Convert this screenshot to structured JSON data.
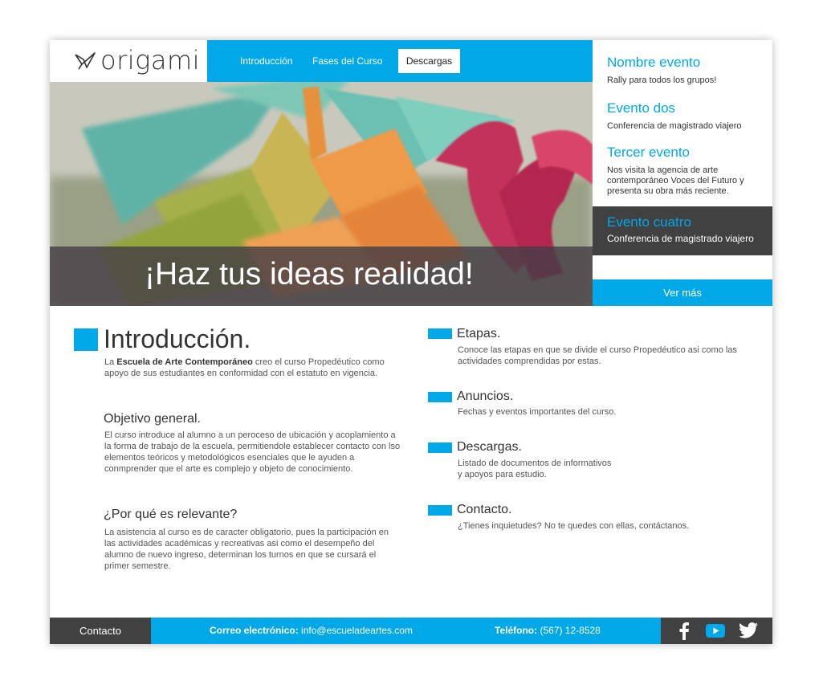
{
  "brand": {
    "logo_text": "origami"
  },
  "nav": {
    "items": [
      {
        "label": "Introducción"
      },
      {
        "label": "Fases del Curso"
      },
      {
        "label": "Descargas"
      }
    ]
  },
  "hero": {
    "headline": "¡Haz tus ideas realidad!"
  },
  "events": {
    "items": [
      {
        "title": "Nombre evento",
        "desc": "Rally para todos los grupos!"
      },
      {
        "title": "Evento dos",
        "desc": "Conferencia de magistrado viajero"
      },
      {
        "title": "Tercer evento",
        "desc": "Nos visita la agencia de arte contemporáneo Voces del Futuro y presenta su obra más reciente."
      },
      {
        "title": "Evento cuatro",
        "desc": "Conferencia de magistrado viajero"
      }
    ],
    "more_label": "Ver más"
  },
  "intro": {
    "title": "Introducción.",
    "body_prefix": "La ",
    "body_bold": "Escuela de Arte Contemporáneo",
    "body_suffix": " creo el curso Propedéutico como apoyo de sus estudiantes en conformidad con el estatuto en vigencia."
  },
  "objective": {
    "title": "Objetivo general.",
    "body": "El curso introduce al alumno a un peroceso de ubicación y acoplamiento a la forma de trabajo de la escuela, permitiendole establecer contacto con lso elementos teóricos y metodológicos esenciales que le ayuden a conmprender que el arte es complejo y objeto de conocimiento."
  },
  "relevance": {
    "title": "¿Por qué es relevante?",
    "body": "La asistencia al curso es de caracter obligatorio, pues la participación en las actividades académicas y recreativas asi como el desempeño del alumno de nuevo ingreso, determinan los turnos en que se cursará el primer semestre."
  },
  "sections": [
    {
      "title": "Etapas.",
      "body": "Conoce las etapas en que se divide el curso Propedéutico asi como las actividades comprendidas por estas."
    },
    {
      "title": "Anuncios.",
      "body": "Fechas y eventos importantes del curso."
    },
    {
      "title": "Descargas.",
      "body_line1": "Listado de documentos de informativos",
      "body_line2": "y apoyos para estudio."
    },
    {
      "title": "Contacto.",
      "body": "¿Tienes inquietudes? No te quedes con ellas, contáctanos."
    }
  ],
  "footer": {
    "contact_label": "Contacto",
    "email_label": "Correo electrónico:",
    "email_value": "info@escueladeartes.com",
    "phone_label": "Teléfono:",
    "phone_value": "(567) 12-8528",
    "social_icons": [
      "facebook-icon",
      "youtube-icon",
      "twitter-icon"
    ]
  },
  "colors": {
    "accent": "#00a8e8",
    "dark": "#414142",
    "text": "#333333"
  }
}
